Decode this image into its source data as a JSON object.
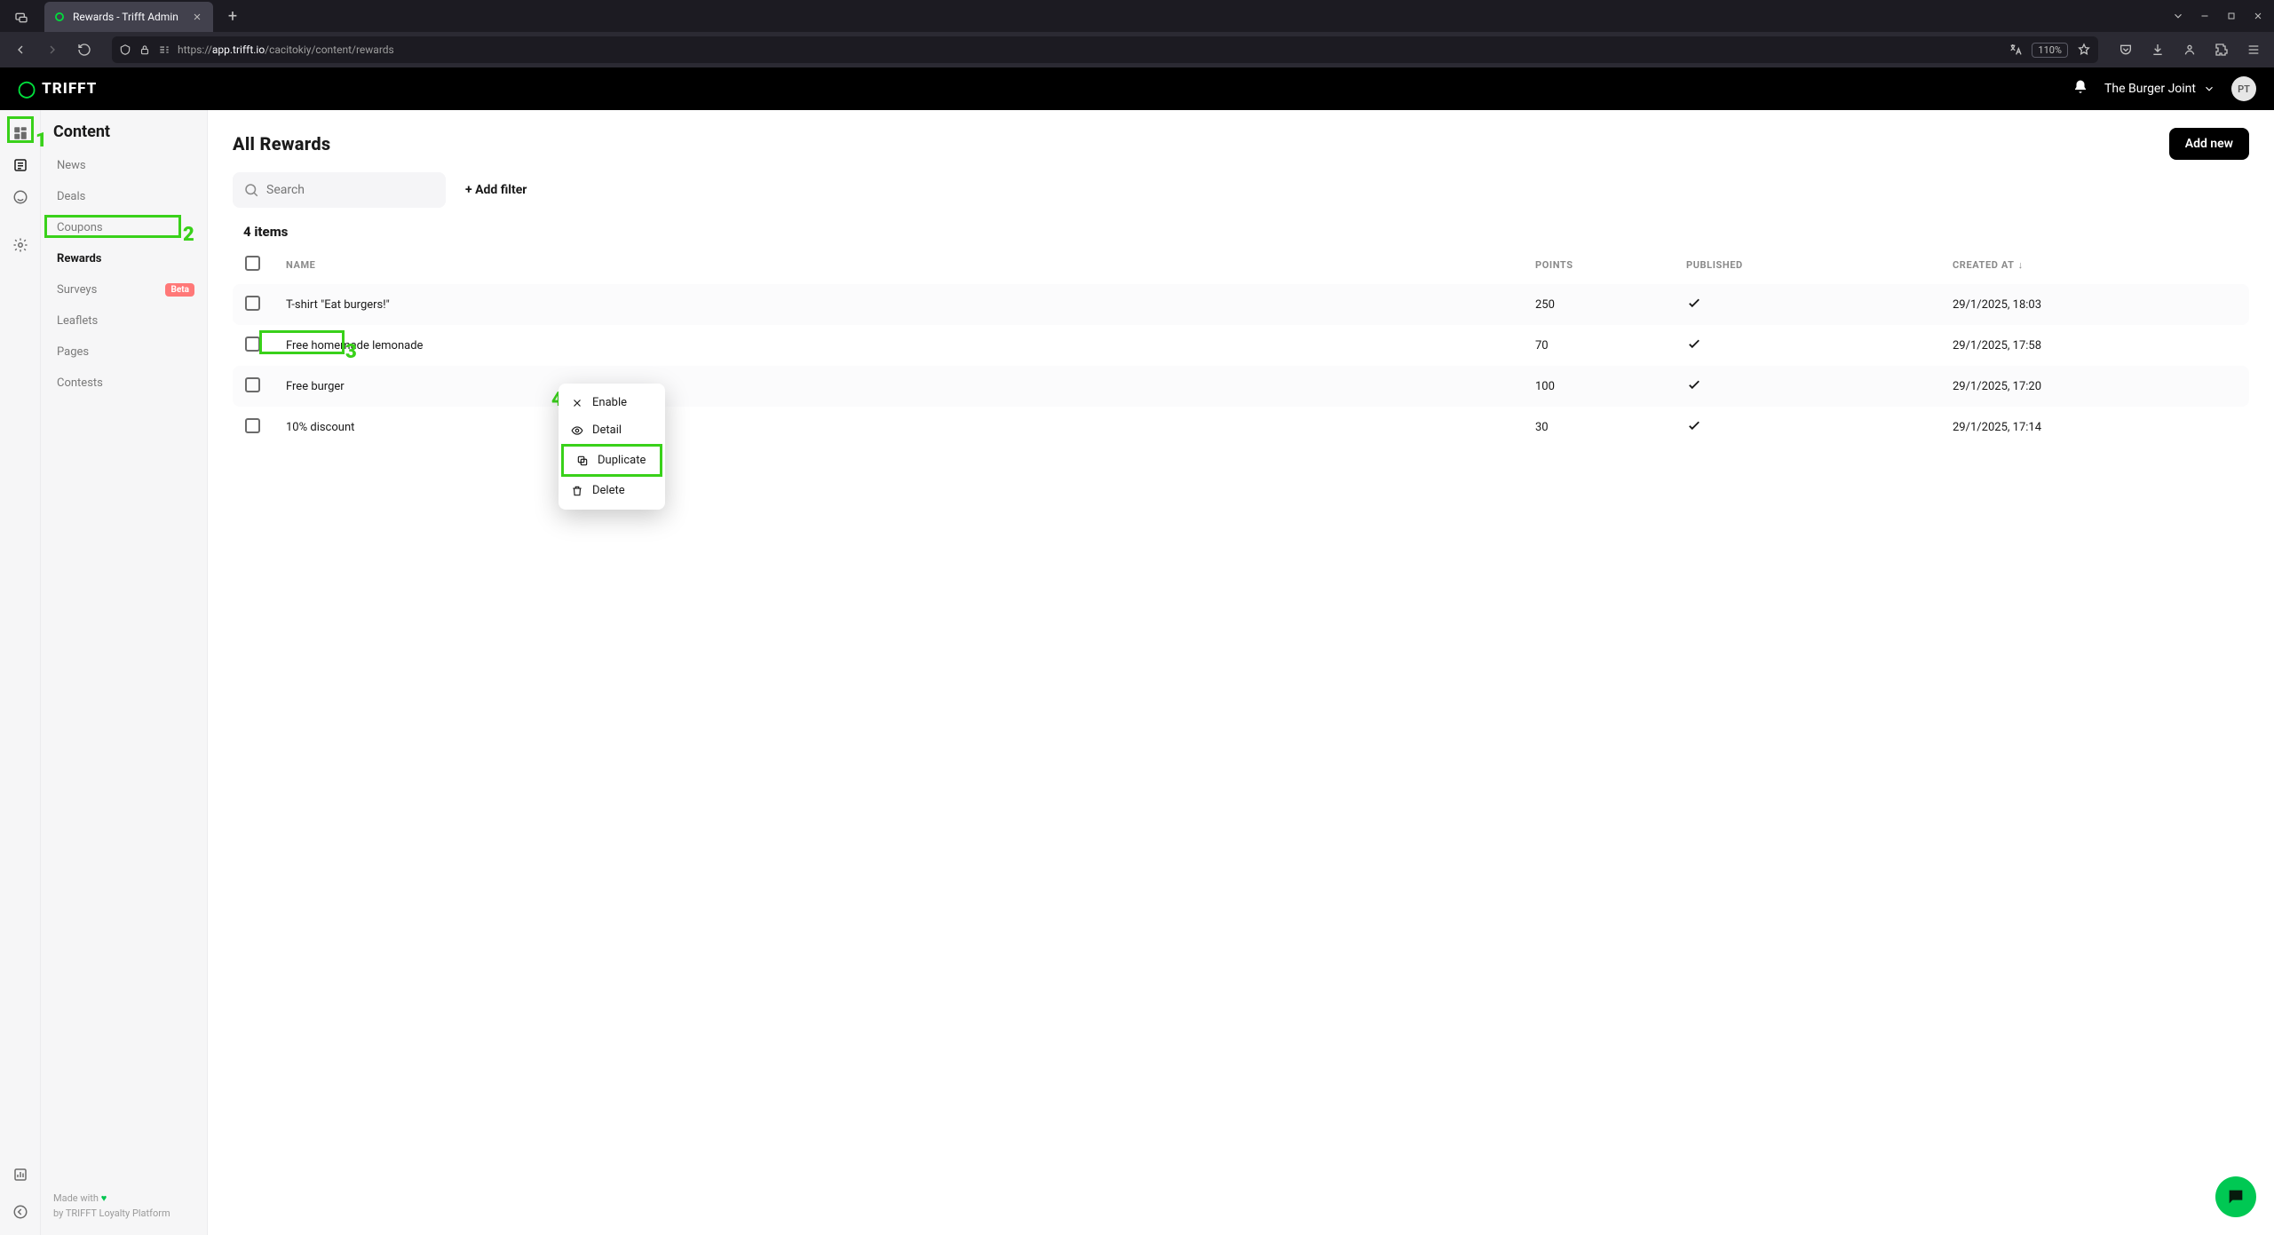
{
  "browser": {
    "tab_title": "Rewards - Trifft Admin",
    "url_prefix": "https://",
    "url_host": "app.trifft.io",
    "url_path": "/cacitokiy/content/rewards",
    "zoom": "110%"
  },
  "app_header": {
    "brand": "TRIFFT",
    "org_name": "The Burger Joint",
    "avatar_initials": "PT"
  },
  "sidebar": {
    "section_title": "Content",
    "items": [
      {
        "label": "News"
      },
      {
        "label": "Deals"
      },
      {
        "label": "Coupons"
      },
      {
        "label": "Rewards",
        "active": true
      },
      {
        "label": "Surveys",
        "badge": "Beta"
      },
      {
        "label": "Leaflets"
      },
      {
        "label": "Pages"
      },
      {
        "label": "Contests"
      }
    ],
    "footer_line1": "Made with",
    "footer_heart": "♥",
    "footer_line2": "by TRIFFT Loyalty Platform"
  },
  "page": {
    "title": "All Rewards",
    "add_button": "Add new",
    "search_placeholder": "Search",
    "add_filter": "+ Add filter",
    "count": "4 items",
    "columns": {
      "name": "NAME",
      "points": "POINTS",
      "published": "PUBLISHED",
      "created": "CREATED AT"
    },
    "rows": [
      {
        "name": "T-shirt \"Eat burgers!\"",
        "points": "250",
        "published": true,
        "created": "29/1/2025, 18:03"
      },
      {
        "name": "Free homemade lemonade",
        "points": "70",
        "published": true,
        "created": "29/1/2025, 17:58"
      },
      {
        "name": "Free burger",
        "points": "100",
        "published": true,
        "created": "29/1/2025, 17:20"
      },
      {
        "name": "10% discount",
        "points": "30",
        "published": true,
        "created": "29/1/2025, 17:14"
      }
    ]
  },
  "context_menu": {
    "items": [
      {
        "label": "Enable",
        "icon": "close"
      },
      {
        "label": "Detail",
        "icon": "eye"
      },
      {
        "label": "Duplicate",
        "icon": "copy",
        "highlight": true
      },
      {
        "label": "Delete",
        "icon": "trash"
      }
    ]
  },
  "annotations": {
    "n1": "1",
    "n2": "2",
    "n3": "3",
    "n4": "4"
  }
}
